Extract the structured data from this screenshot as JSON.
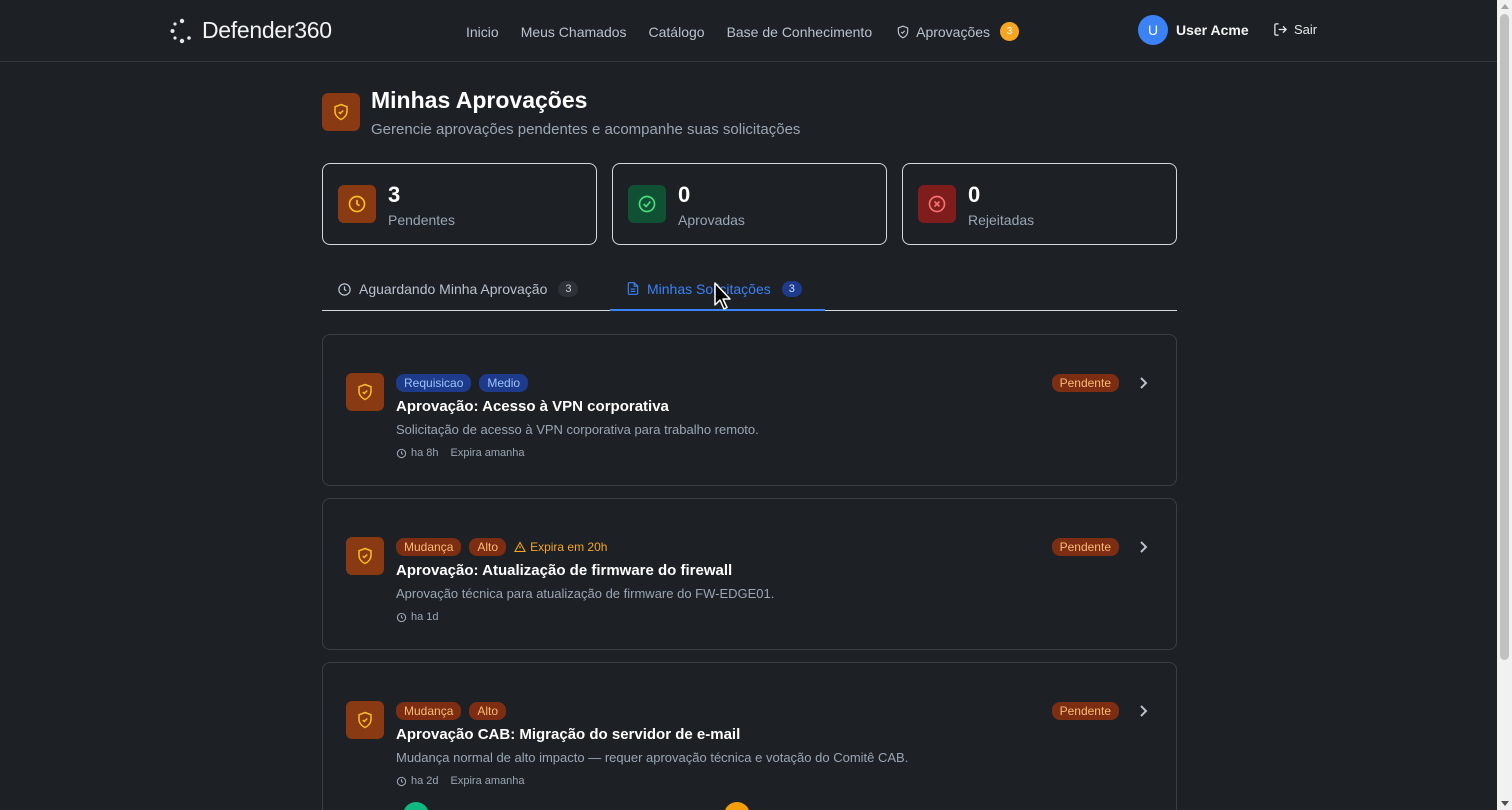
{
  "app": {
    "brand": "Defender360"
  },
  "nav": {
    "inicio": "Inicio",
    "meus_chamados": "Meus Chamados",
    "catalogo": "Catálogo",
    "base": "Base de Conhecimento",
    "aprovacoes": "Aprovações",
    "aprovacoes_count": "3"
  },
  "user": {
    "initial": "U",
    "name": "User Acme",
    "logout": "Sair"
  },
  "page": {
    "title": "Minhas Aprovações",
    "subtitle": "Gerencie aprovações pendentes e acompanhe suas solicitações"
  },
  "stats": [
    {
      "value": "3",
      "label": "Pendentes",
      "color": "#8a3a12",
      "icon": "clock-icon"
    },
    {
      "value": "0",
      "label": "Aprovadas",
      "color": "#0f5132",
      "icon": "check-circle-icon"
    },
    {
      "value": "0",
      "label": "Rejeitadas",
      "color": "#7f1d1d",
      "icon": "x-circle-icon"
    }
  ],
  "tabs": [
    {
      "label": "Aguardando Minha Aprovação",
      "count": "3",
      "active": false
    },
    {
      "label": "Minhas Solicitações",
      "count": "3",
      "active": true
    }
  ],
  "cards": [
    {
      "tags": [
        "Requisicao",
        "Medio"
      ],
      "title": "Aprovação: Acesso à VPN corporativa",
      "description": "Solicitação de acesso à VPN corporativa para trabalho remoto.",
      "time": "ha 8h",
      "expires": "Expira amanha",
      "status": "Pendente"
    },
    {
      "tags": [
        "Mudança",
        "Alto"
      ],
      "warning": "Expira em 20h",
      "title": "Aprovação: Atualização de firmware do firewall",
      "description": "Aprovação técnica para atualização de firmware do FW-EDGE01.",
      "time": "ha 1d",
      "status": "Pendente"
    },
    {
      "tags": [
        "Mudança",
        "Alto"
      ],
      "title": "Aprovação CAB: Migração do servidor de e-mail",
      "description": "Mudança normal de alto impacto — requer aprovação técnica e votação do Comitê CAB.",
      "time": "ha 2d",
      "expires": "Expira amanha",
      "status": "Pendente"
    }
  ],
  "colors": {
    "accent": "#3b82f6",
    "warning": "#f5a623",
    "background": "#1d2024"
  }
}
